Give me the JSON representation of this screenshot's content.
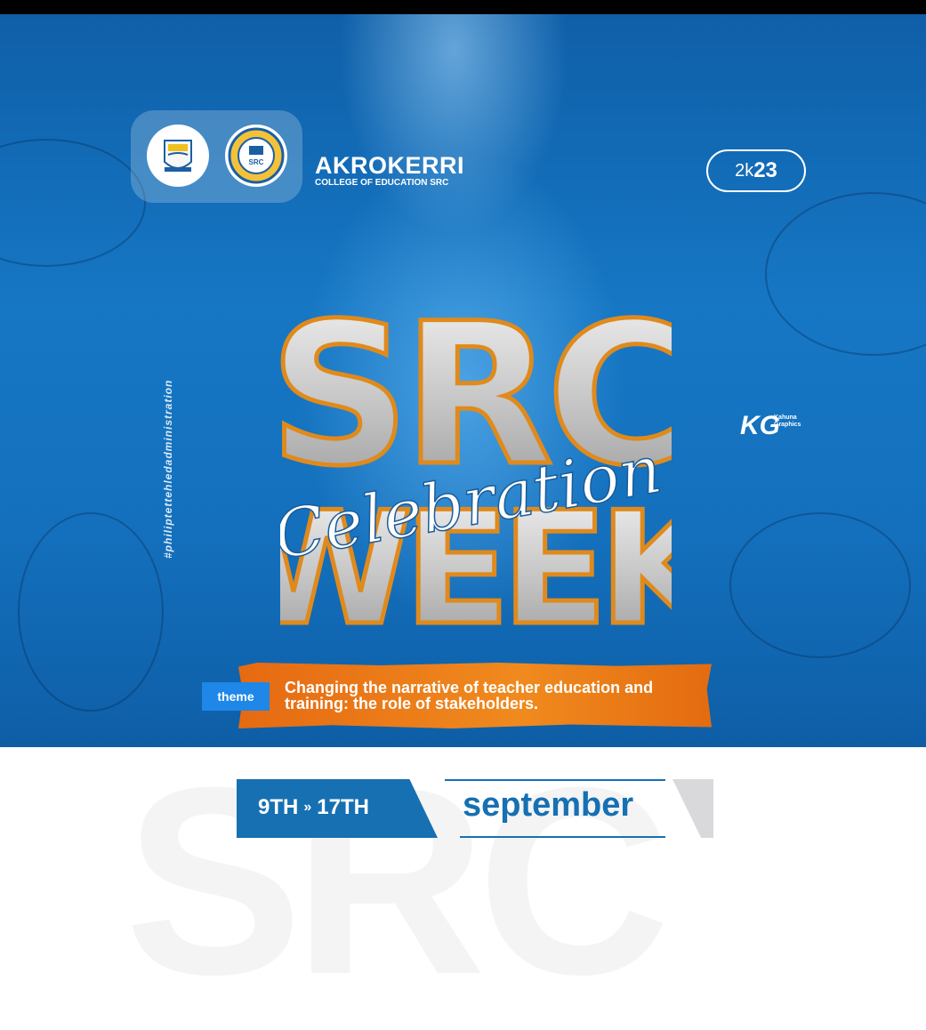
{
  "header": {
    "college_name": "AKROKERRI",
    "college_sub": "COLLEGE OF EDUCATION SRC",
    "year_badge_prefix": "2k",
    "year_badge_suffix": "23",
    "logos": [
      "college-crest",
      "src-seal"
    ],
    "seal_text": "SRC"
  },
  "hero": {
    "line1": "SRC",
    "script": "Celebration",
    "line2": "WEEK"
  },
  "side": {
    "hashtag": "#philiptettehledadministration",
    "brand_mark": "KG",
    "brand_name": "Kahuna Graphics"
  },
  "theme": {
    "tag": "theme",
    "text": "Changing the narrative of teacher education and training: the role of stakeholders."
  },
  "dates": {
    "start": "9TH",
    "separator": "»",
    "end": "17TH",
    "month": "september"
  },
  "background_text": "SRC",
  "colors": {
    "poster_blue": "#1677c4",
    "banner_orange": "#f08a1e",
    "tag_blue": "#1e87e8",
    "date_blue": "#1670b2"
  }
}
